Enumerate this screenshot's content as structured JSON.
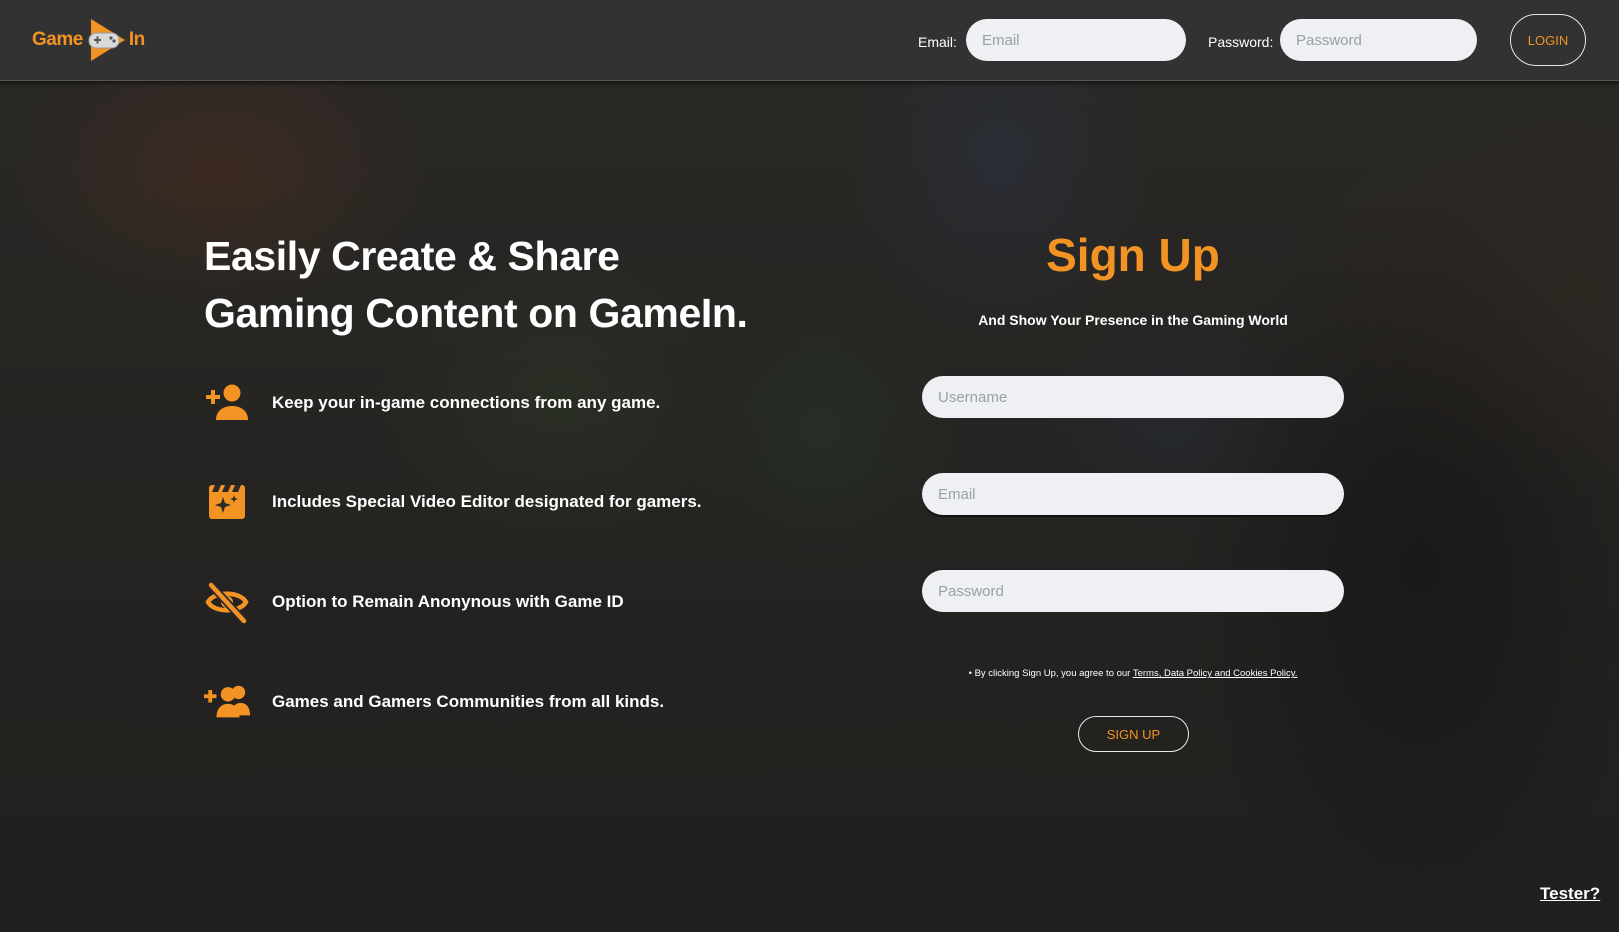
{
  "brand": {
    "logo_left": "Game",
    "logo_right": "In",
    "accent_color": "#f29324"
  },
  "header": {
    "email_label": "Email:",
    "email_placeholder": "Email",
    "email_value": "",
    "password_label": "Password:",
    "password_placeholder": "Password",
    "password_value": "",
    "login_label": "LOGIN"
  },
  "hero": {
    "title": "Easily Create & Share Gaming Content on GameIn.",
    "features": [
      {
        "icon": "add-person-icon",
        "text": "Keep your in-game connections from any game."
      },
      {
        "icon": "video-sparkle-icon",
        "text": "Includes Special Video Editor designated for gamers."
      },
      {
        "icon": "eye-off-icon",
        "text": "Option to Remain Anonynous with Game ID"
      },
      {
        "icon": "add-group-icon",
        "text": "Games and Gamers Communities from all kinds."
      }
    ]
  },
  "signup": {
    "title": "Sign Up",
    "subtitle": "And Show Your Presence in the Gaming World",
    "username_placeholder": "Username",
    "email_placeholder": "Email",
    "password_placeholder": "Password",
    "terms_prefix": "• By clicking Sign Up, you agree to our ",
    "terms_link": "Terms, Data Policy and Cookies Policy.",
    "button_label": "SIGN UP"
  },
  "footer": {
    "tester_link": "Tester?"
  }
}
